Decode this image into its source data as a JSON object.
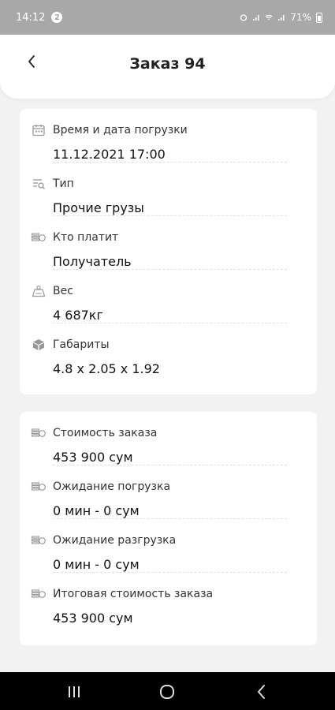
{
  "status_bar": {
    "time": "14:12",
    "badge": "2",
    "battery": "71%"
  },
  "header": {
    "title": "Заказ 94",
    "back_icon": "chevron-left-icon"
  },
  "cargo_details": [
    {
      "icon": "calendar-icon",
      "label": "Время и дата погрузки",
      "value": "11.12.2021 17:00"
    },
    {
      "icon": "list-search-icon",
      "label": "Тип",
      "value": "Прочие грузы"
    },
    {
      "icon": "money-icon",
      "label": "Кто платит",
      "value": "Получатель"
    },
    {
      "icon": "weight-icon",
      "label": "Вес",
      "value": "4 687кг"
    },
    {
      "icon": "box-icon",
      "label": "Габариты",
      "value": "4.8 x 2.05 x 1.92"
    }
  ],
  "cost_details": [
    {
      "icon": "money-icon",
      "label": "Стоимость заказа",
      "value": "453 900 сум"
    },
    {
      "icon": "money-icon",
      "label": "Ожидание погрузка",
      "value": "0 мин - 0 сум"
    },
    {
      "icon": "money-icon",
      "label": "Ожидание разгрузка",
      "value": "0 мин - 0 сум"
    },
    {
      "icon": "money-icon",
      "label": "Итоговая стоимость заказа",
      "value": "453 900 сум"
    }
  ],
  "nav_bar": {
    "recents_icon": "recents-icon",
    "home_icon": "home-icon",
    "back_icon": "back-icon"
  }
}
